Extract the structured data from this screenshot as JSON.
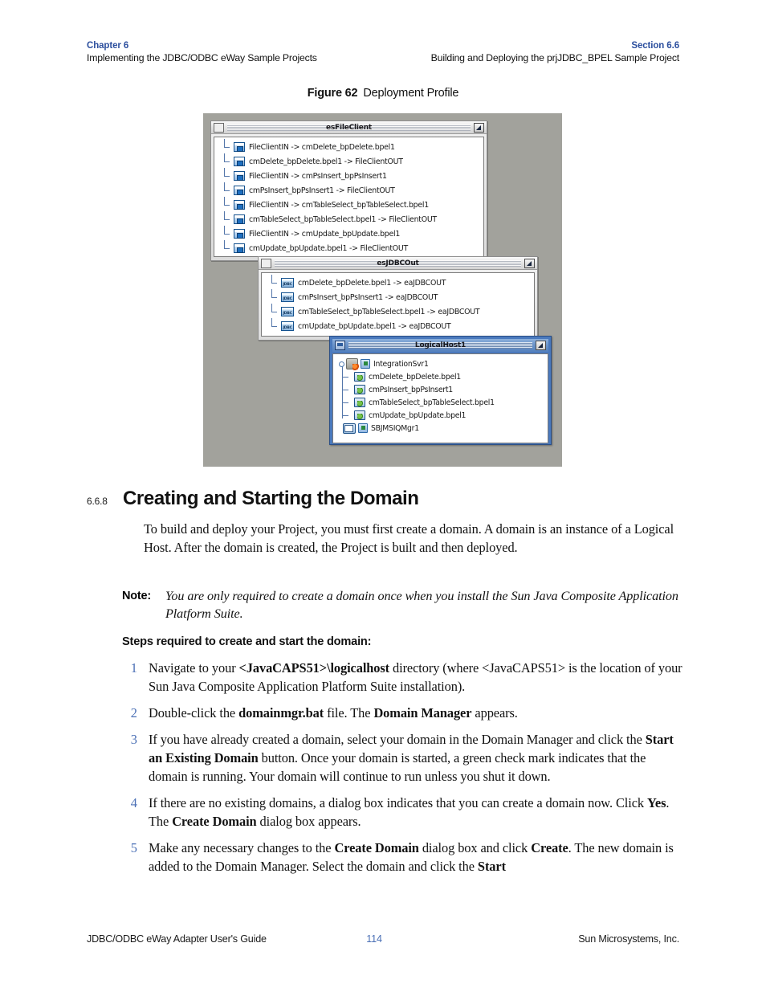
{
  "header": {
    "left_chapter": "Chapter 6",
    "left_sub": "Implementing the JDBC/ODBC eWay Sample Projects",
    "right_section": "Section 6.6",
    "right_sub": "Building and Deploying the prjJDBC_BPEL Sample Project"
  },
  "figure": {
    "caption_label": "Figure 62",
    "caption_text": "Deployment Profile",
    "windows": [
      {
        "title": "esFileClient",
        "titlebar_icon": "window-icon",
        "restore_icon": "restore-down-icon",
        "items": [
          {
            "icon": "connection-window-icon",
            "label": "FileClientIN -> cmDelete_bpDelete.bpel1"
          },
          {
            "icon": "connection-window-icon",
            "label": "cmDelete_bpDelete.bpel1 -> FileClientOUT"
          },
          {
            "icon": "connection-window-icon",
            "label": "FileClientIN -> cmPsInsert_bpPsInsert1"
          },
          {
            "icon": "connection-window-icon",
            "label": "cmPsInsert_bpPsInsert1 -> FileClientOUT"
          },
          {
            "icon": "connection-window-icon",
            "label": "FileClientIN -> cmTableSelect_bpTableSelect.bpel1"
          },
          {
            "icon": "connection-window-icon",
            "label": "cmTableSelect_bpTableSelect.bpel1 -> FileClientOUT"
          },
          {
            "icon": "connection-window-icon",
            "label": "FileClientIN -> cmUpdate_bpUpdate.bpel1"
          },
          {
            "icon": "connection-window-icon",
            "label": "cmUpdate_bpUpdate.bpel1 -> FileClientOUT"
          }
        ]
      },
      {
        "title": "esJDBCOut",
        "titlebar_icon": "window-icon",
        "restore_icon": "restore-down-icon",
        "items": [
          {
            "icon": "jdbc-icon",
            "icon_text": "JDBC",
            "label": "cmDelete_bpDelete.bpel1 -> eaJDBCOUT"
          },
          {
            "icon": "jdbc-icon",
            "icon_text": "JDBC",
            "label": "cmPsInsert_bpPsInsert1 -> eaJDBCOUT"
          },
          {
            "icon": "jdbc-icon",
            "icon_text": "JDBC",
            "label": "cmTableSelect_bpTableSelect.bpel1 -> eaJDBCOUT"
          },
          {
            "icon": "jdbc-icon",
            "icon_text": "JDBC",
            "label": "cmUpdate_bpUpdate.bpel1 -> eaJDBCOUT"
          }
        ]
      },
      {
        "title": "LogicalHost1",
        "titlebar_icon": "computer-icon",
        "restore_icon": "restore-down-icon",
        "root": {
          "icon": "integration-server-icon",
          "badge": "deploy-flag-icon",
          "label": "IntegrationSvr1"
        },
        "children": [
          {
            "icon": "deployment-icon",
            "label": "cmDelete_bpDelete.bpel1"
          },
          {
            "icon": "deployment-icon",
            "label": "cmPsInsert_bpPsInsert1"
          },
          {
            "icon": "deployment-icon",
            "label": "cmTableSelect_bpTableSelect.bpel1"
          },
          {
            "icon": "deployment-icon",
            "label": "cmUpdate_bpUpdate.bpel1"
          }
        ],
        "sibling": {
          "icon": "jms-queue-icon",
          "badge": "deploy-flag-icon",
          "label": "SBJMSIQMgr1"
        }
      }
    ]
  },
  "section": {
    "number": "6.6.8",
    "title": "Creating and Starting the Domain",
    "intro": "To build and deploy your Project, you must first create a domain. A domain is an instance of a Logical Host. After the domain is created, the Project is built and then deployed."
  },
  "note": {
    "label": "Note:",
    "text": "You are only required to create a domain once when you install the Sun Java Composite Application Platform Suite."
  },
  "steps_heading": "Steps required to create and start the domain:",
  "steps": [
    {
      "num": "1",
      "text": "Navigate to your <JavaCAPS51>\\logicalhost directory (where <JavaCAPS51> is the location of your Sun Java Composite Application Platform Suite installation)."
    },
    {
      "num": "2",
      "text": "Double-click the domainmgr.bat file. The Domain Manager appears."
    },
    {
      "num": "3",
      "text": "If you have already created a domain, select your domain in the Domain Manager and click the Start an Existing Domain button. Once your domain is started, a green check mark indicates that the domain is running. Your domain will continue to run unless you shut it down."
    },
    {
      "num": "4",
      "text": "If there are no existing domains, a dialog box indicates that you can create a domain now. Click Yes. The Create Domain dialog box appears."
    },
    {
      "num": "5",
      "text": "Make any necessary changes to the Create Domain dialog box and click Create. The new domain is added to the Domain Manager. Select the domain and click the Start"
    }
  ],
  "footer": {
    "left": "JDBC/ODBC eWay Adapter User's Guide",
    "page": "114",
    "right": "Sun Microsystems, Inc."
  },
  "colors": {
    "accent_blue": "#4a6fb5",
    "heading_blue": "#2c4f9e",
    "figure_bg": "#a2a29c",
    "active_window_frame": "#4a79bd"
  }
}
